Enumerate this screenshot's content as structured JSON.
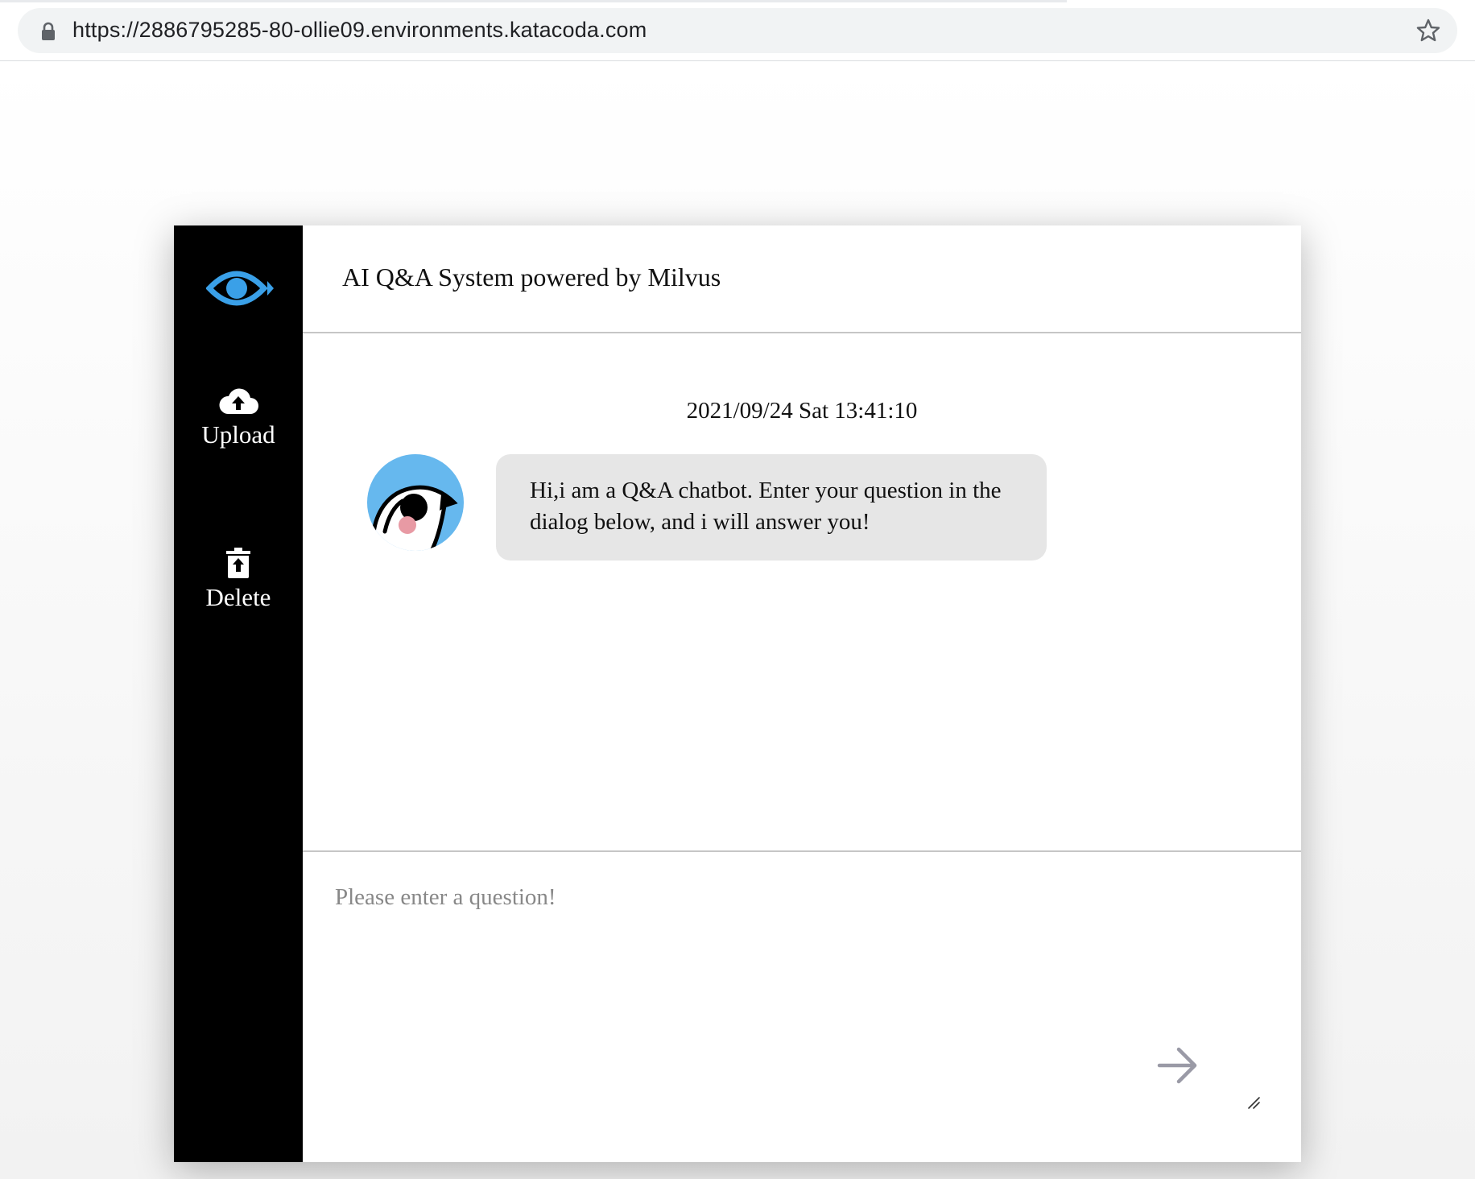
{
  "browser": {
    "url": "https://2886795285-80-ollie09.environments.katacoda.com"
  },
  "header": {
    "title": "AI Q&A System powered by Milvus"
  },
  "sidebar": {
    "items": [
      {
        "label": "Upload",
        "icon": "cloud-upload-icon"
      },
      {
        "label": "Delete",
        "icon": "trash-icon"
      }
    ]
  },
  "chat": {
    "timestamp": "2021/09/24 Sat 13:41:10",
    "messages": [
      {
        "sender": "bot",
        "text": "Hi,i am a Q&A chatbot. Enter your question in the dialog below, and i will answer you!"
      }
    ]
  },
  "input": {
    "placeholder": "Please enter a question!",
    "value": ""
  },
  "colors": {
    "sidebar_bg": "#000000",
    "logo_accent": "#3aa0e8",
    "bubble_bg": "#e6e6e6",
    "avatar_bg": "#66b8ee"
  }
}
